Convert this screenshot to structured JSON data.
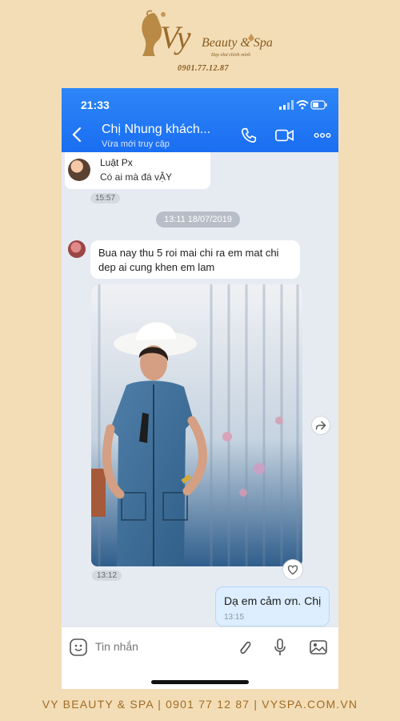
{
  "brand": {
    "logo_initials": "Vy",
    "logo_name": "Beauty & Spa",
    "logo_tagline": "Đẹp như chính mình",
    "phone": "0901.77.12.87"
  },
  "status": {
    "time": "21:33"
  },
  "chat": {
    "title": "Chị Nhung khách...",
    "subtitle": "Vừa mới truy cập"
  },
  "quoted": {
    "name": "Luật Px",
    "message": "Có ai mà đá vẬY",
    "time": "15:57"
  },
  "date_divider": "13:11 18/07/2019",
  "incoming": {
    "text": "Bua nay thu 5 roi mai chi ra em mat chi dep ai cung khen em lam",
    "photo_time": "13:12"
  },
  "outgoing": {
    "text": "Dạ em cảm ơn. Chị",
    "time": "13:15"
  },
  "input": {
    "placeholder": "Tin nhắn"
  },
  "footer": "VY BEAUTY & SPA  |  0901 77 12 87  |  VYSPA.COM.VN",
  "colors": {
    "header": "#1a6ef2",
    "background": "#f2ddb7",
    "accent": "#a16b24"
  },
  "icons": [
    "back-icon",
    "phone-icon",
    "video-icon",
    "more-icon",
    "forward-icon",
    "heart-icon",
    "emoji-icon",
    "paperclip-icon",
    "microphone-icon",
    "image-icon"
  ]
}
